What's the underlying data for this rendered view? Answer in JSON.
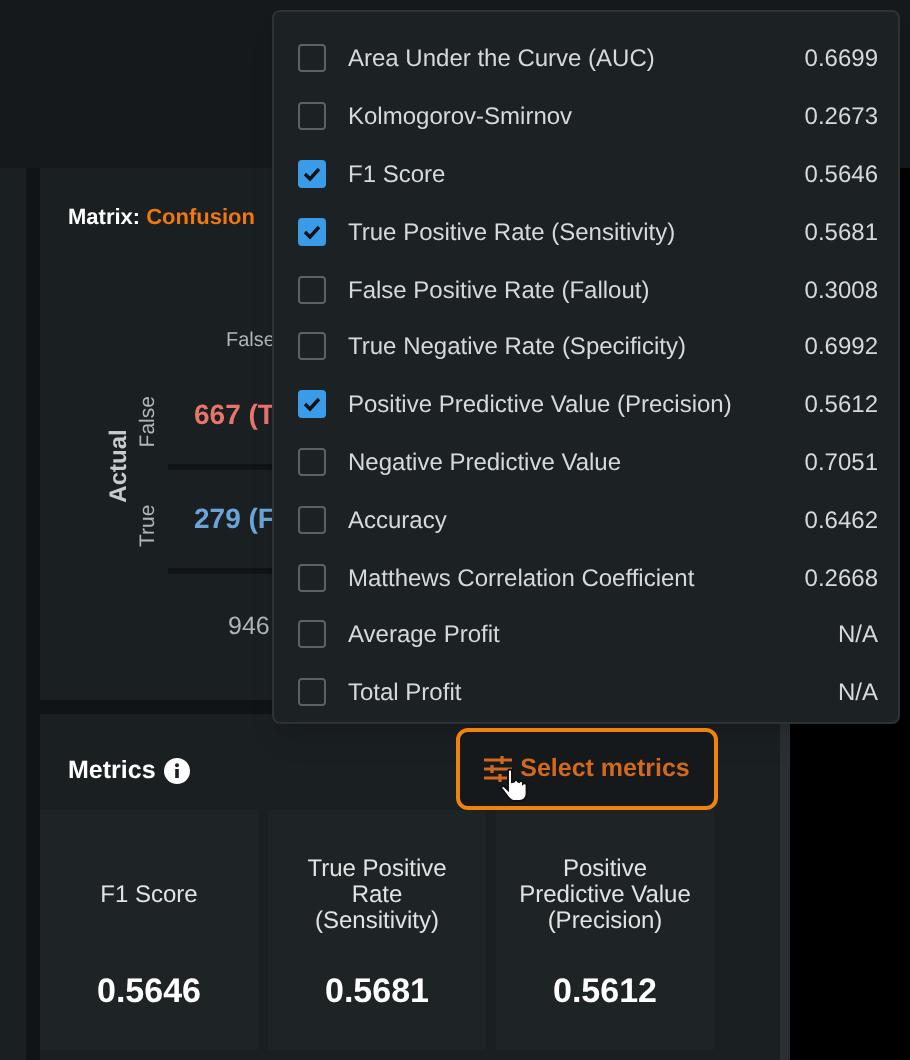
{
  "matrix": {
    "label": "Matrix:",
    "value": "Confusion",
    "column_header": "False",
    "row_axis": "Actual",
    "rows": [
      {
        "label": "False",
        "cell": "667 (T",
        "color": "#e8756a"
      },
      {
        "label": "True",
        "cell": "279 (F",
        "color": "#6aa4d8"
      }
    ],
    "total": "946"
  },
  "metrics": {
    "title": "Metrics",
    "cards": [
      {
        "label": "F1 Score",
        "value": "0.5646"
      },
      {
        "label": "True Positive Rate (Sensitivity)",
        "value": "0.5681"
      },
      {
        "label": "Positive Predictive Value (Precision)",
        "value": "0.5612"
      }
    ]
  },
  "dropdown": {
    "items": [
      {
        "label": "Area Under the Curve (AUC)",
        "value": "0.6699",
        "checked": false
      },
      {
        "label": "Kolmogorov-Smirnov",
        "value": "0.2673",
        "checked": false
      },
      {
        "label": "F1 Score",
        "value": "0.5646",
        "checked": true
      },
      {
        "label": "True Positive Rate (Sensitivity)",
        "value": "0.5681",
        "checked": true
      },
      {
        "label": "False Positive Rate (Fallout)",
        "value": "0.3008",
        "checked": false
      },
      {
        "label": "True Negative Rate (Specificity)",
        "value": "0.6992",
        "checked": false
      },
      {
        "label": "Positive Predictive Value (Precision)",
        "value": "0.5612",
        "checked": true
      },
      {
        "label": "Negative Predictive Value",
        "value": "0.7051",
        "checked": false
      },
      {
        "label": "Accuracy",
        "value": "0.6462",
        "checked": false
      },
      {
        "label": "Matthews Correlation Coefficient",
        "value": "0.2668",
        "checked": false
      },
      {
        "label": "Average Profit",
        "value": "N/A",
        "checked": false
      },
      {
        "label": "Total Profit",
        "value": "N/A",
        "checked": false
      }
    ]
  },
  "select_button": {
    "label": "Select metrics"
  }
}
